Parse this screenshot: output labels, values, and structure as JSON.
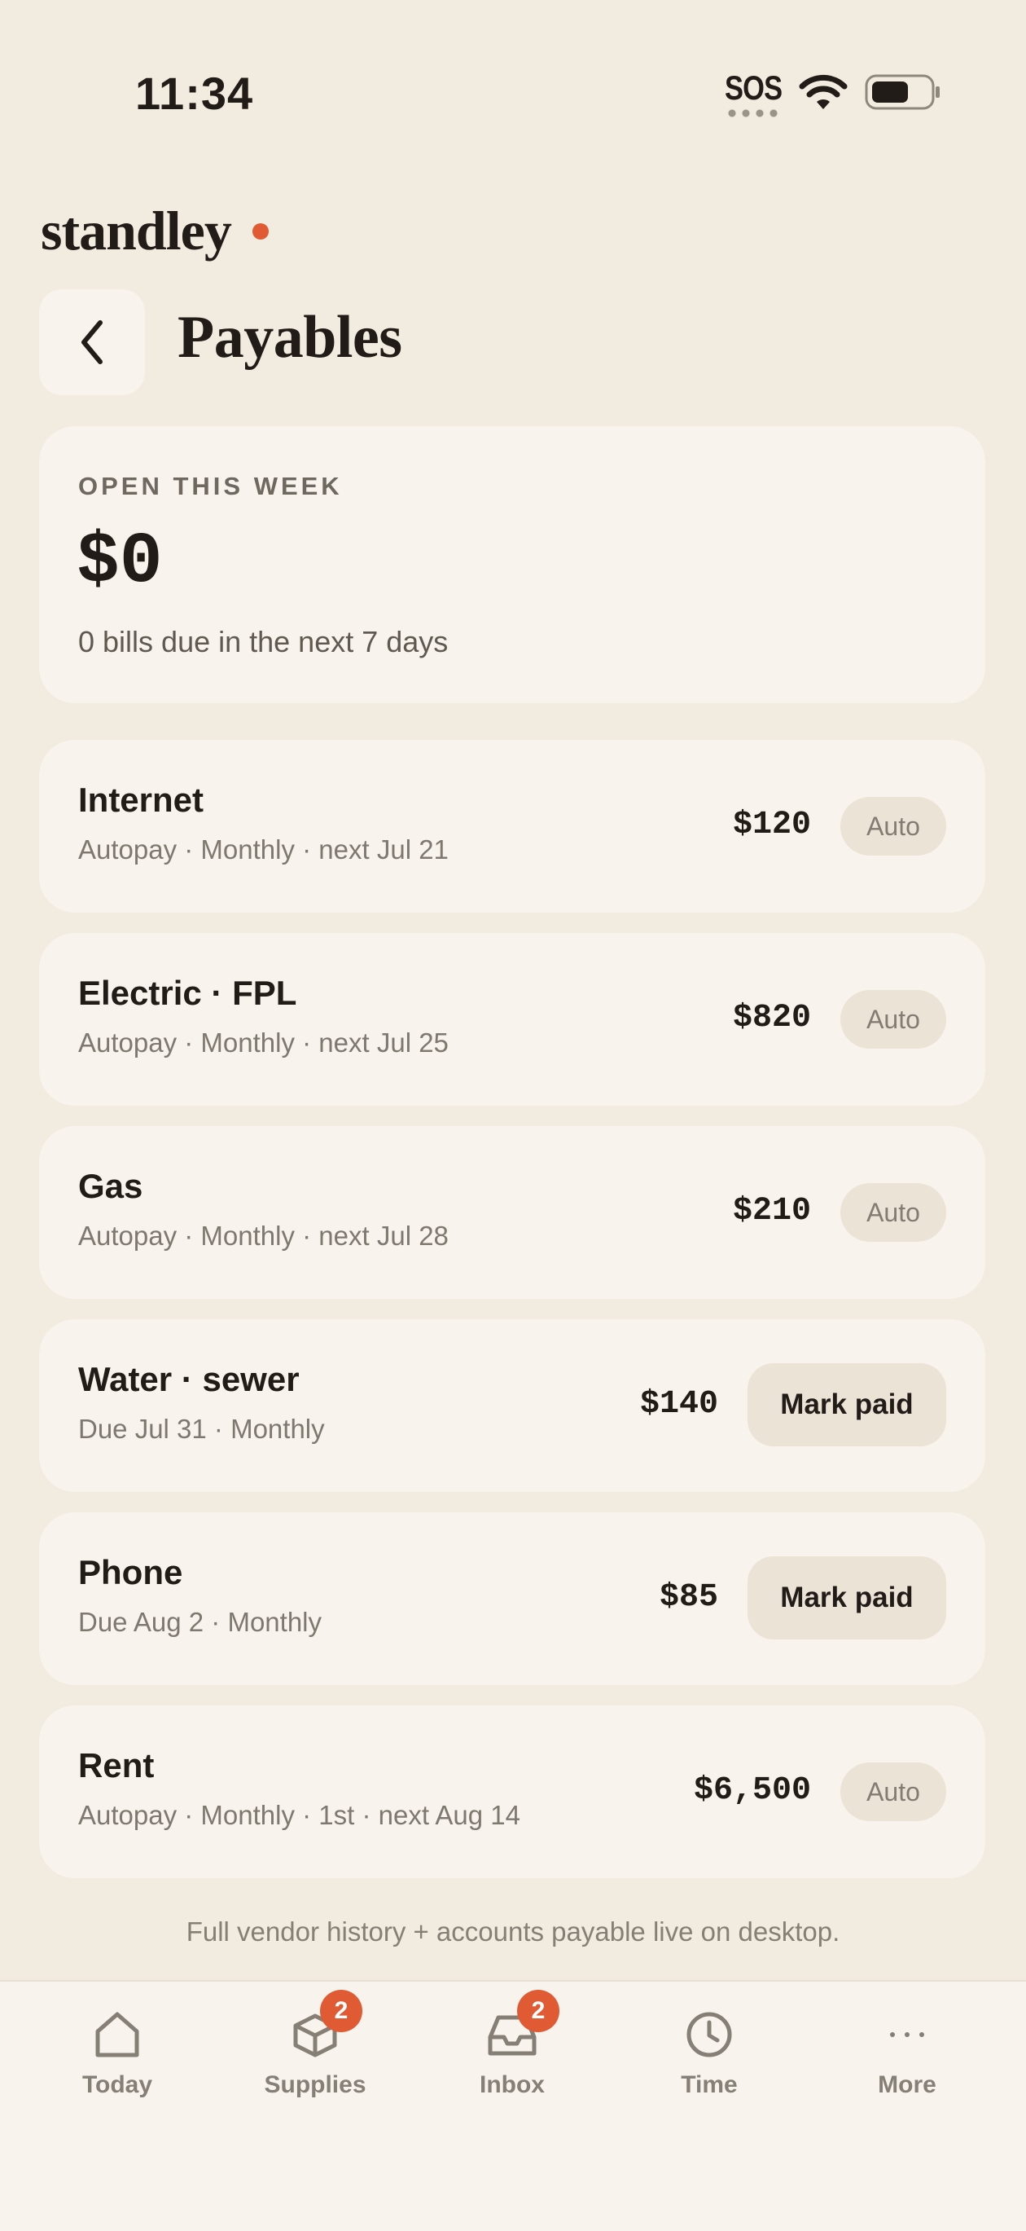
{
  "status_bar": {
    "time": "11:34",
    "sos": "SOS"
  },
  "brand": {
    "name": "standley",
    "accent_color": "#E05A33"
  },
  "header": {
    "title": "Payables",
    "back_icon": "chevron-left-icon"
  },
  "summary": {
    "label": "OPEN THIS WEEK",
    "amount": "$0",
    "subtitle": "0 bills due in the next 7 days"
  },
  "bills": [
    {
      "name": "Internet",
      "meta": "Autopay · Monthly · next Jul 21",
      "amount": "$120",
      "action": "Auto"
    },
    {
      "name": "Electric · FPL",
      "meta": "Autopay · Monthly · next Jul 25",
      "amount": "$820",
      "action": "Auto"
    },
    {
      "name": "Gas",
      "meta": "Autopay · Monthly · next Jul 28",
      "amount": "$210",
      "action": "Auto"
    },
    {
      "name": "Water · sewer",
      "meta": "Due Jul 31 · Monthly",
      "amount": "$140",
      "action": "Mark paid"
    },
    {
      "name": "Phone",
      "meta": "Due Aug 2 · Monthly",
      "amount": "$85",
      "action": "Mark paid"
    },
    {
      "name": "Rent",
      "meta": "Autopay · Monthly · 1st · next Aug 14",
      "amount": "$6,500",
      "action": "Auto"
    }
  ],
  "footer_note": "Full vendor history + accounts payable live on desktop.",
  "tabs": [
    {
      "label": "Today",
      "icon": "home-icon"
    },
    {
      "label": "Supplies",
      "icon": "box-icon",
      "badge": "2"
    },
    {
      "label": "Inbox",
      "icon": "inbox-icon",
      "badge": "2"
    },
    {
      "label": "Time",
      "icon": "clock-icon"
    },
    {
      "label": "More",
      "icon": "ellipsis-icon"
    }
  ]
}
